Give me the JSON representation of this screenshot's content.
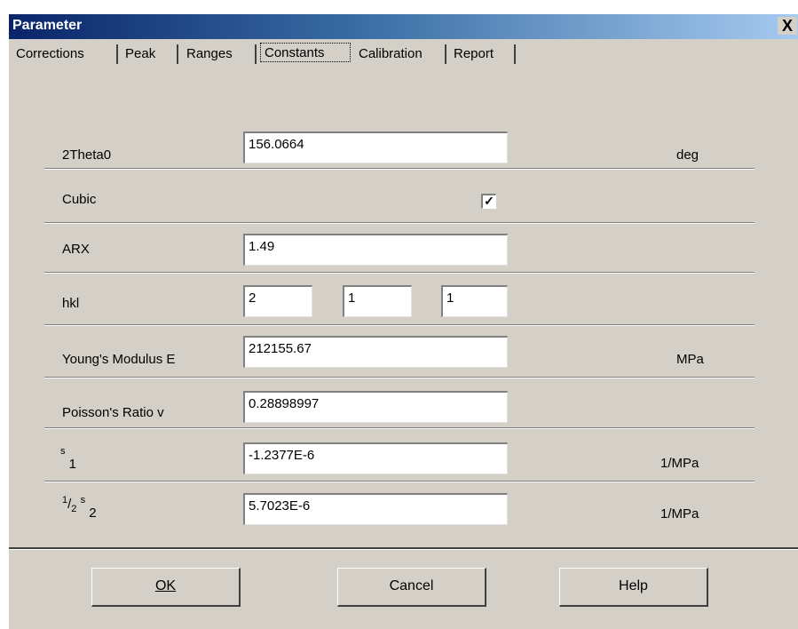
{
  "window": {
    "title": "Parameter",
    "close_glyph": "X"
  },
  "tabs": [
    {
      "label": "Corrections"
    },
    {
      "label": "Peak"
    },
    {
      "label": "Ranges"
    },
    {
      "label": "Constants"
    },
    {
      "label": "Calibration"
    },
    {
      "label": "Report"
    }
  ],
  "fields": {
    "two_theta0": {
      "label": "2Theta0",
      "value": "156.0664",
      "unit": "deg"
    },
    "cubic": {
      "label": "Cubic",
      "checked": true,
      "check_glyph": "✓"
    },
    "arx": {
      "label": "ARX",
      "value": "1.49"
    },
    "hkl": {
      "label": "hkl",
      "h": "2",
      "k": "1",
      "l": "1"
    },
    "youngs": {
      "label": "Young's Modulus E",
      "value": "212155.67",
      "unit": "MPa"
    },
    "poisson": {
      "label": "Poisson's Ratio v",
      "value": "0.28898997"
    },
    "s1": {
      "label_base": "s",
      "label_sub": "1",
      "value": "-1.2377E-6",
      "unit": "1/MPa"
    },
    "half_s2": {
      "label_num": "1",
      "label_den": "2",
      "label_base": "s",
      "label_sub": "2",
      "value": "5.7023E-6",
      "unit": "1/MPa"
    }
  },
  "buttons": {
    "ok": "OK",
    "cancel": "Cancel",
    "help": "Help"
  }
}
